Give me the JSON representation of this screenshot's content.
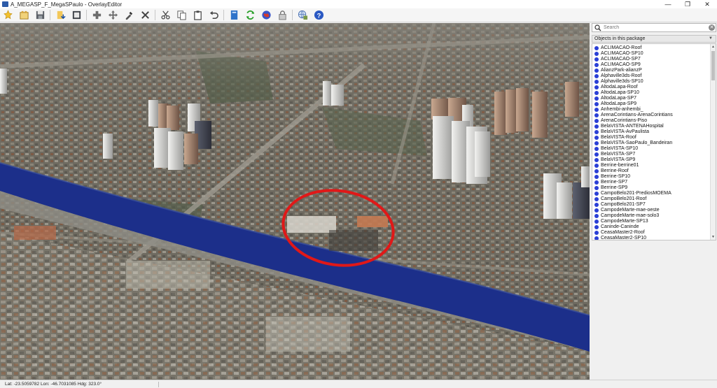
{
  "window": {
    "title": "A_MEGASP_F_MegaSPaulo - OverlayEditor",
    "controls": [
      "—",
      "❐",
      "✕"
    ]
  },
  "toolbar": {
    "icons": [
      "new-icon",
      "open-icon",
      "save-icon",
      "import-icon",
      "export-icon",
      "add-icon",
      "move-icon",
      "paint-icon",
      "delete-icon",
      "cut-icon",
      "copy-icon",
      "paste-icon",
      "undo-icon",
      "preferences-icon",
      "refresh-icon",
      "globe-icon",
      "lock-icon",
      "network-icon",
      "help-icon"
    ]
  },
  "search": {
    "placeholder": "Search",
    "value": ""
  },
  "package_select": {
    "value": "Objects in this package"
  },
  "objects": [
    "ACLIMACAO-Roof",
    "ACLIMACAO-SP10",
    "ACLIMACAO-SP7",
    "ACLIMACAO-SP9",
    "AlianzPark-alianzP",
    "Alphaville3ds-Roof",
    "Alphaville3ds-SP10",
    "AltodaLapa-Roof",
    "AltodaLapa-SP10",
    "AltodaLapa-SP7",
    "AltodaLapa-SP9",
    "Anhembi-anhembi_",
    "ArenaCorintians-ArenaCorintians",
    "ArenaCorintians-Piso",
    "BelaVISTA-ANTENAHospital",
    "BelaVISTA-AvPaulista",
    "BelaVISTA-Roof",
    "BelaVISTA-SaoPaulo_Bandeiran",
    "BelaVISTA-SP10",
    "BelaVISTA-SP7",
    "BelaVISTA-SP9",
    "Berrine-berrine01",
    "Berrine-Roof",
    "Berrine-SP10",
    "Berrine-SP7",
    "Berrine-SP9",
    "CampoBelo201-PrediosMOEMA",
    "CampoBelo201-Roof",
    "CampoBelo201-SP7",
    "CampodeMarte-mae-oeste",
    "CampodeMarte-mae-solo3",
    "CampodeMarte-SP13",
    "Caninde-Caninde",
    "CeasaMaster2-Roof",
    "CeasaMaster2-SP10"
  ],
  "status": {
    "text": "Lat: -23.5059782  Lon: -46.7031085  Hdg: 323.0°"
  },
  "colors": {
    "river": "#1c2f8a",
    "circle": "#e01818",
    "list_dot": "#2a3fd6"
  }
}
